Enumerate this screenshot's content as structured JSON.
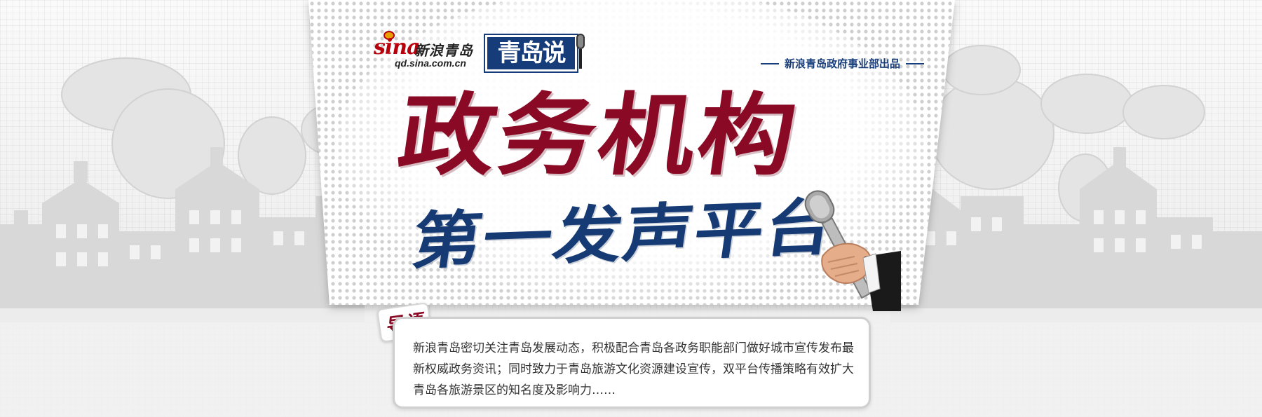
{
  "brand": {
    "sina_mark": "sina",
    "sina_name": "新浪青岛",
    "sina_url": "qd.sina.com.cn",
    "program_logo": "青岛说",
    "producer": "新浪青岛政府事业部出品"
  },
  "headline": {
    "line1": "政务机构",
    "line2": "第一发声平台"
  },
  "intro": {
    "tag": "导语",
    "text": "新浪青岛密切关注青岛发展动态，积极配合青岛各政务职能部门做好城市宣传发布最新权威政务资讯；同时致力于青岛旅游文化资源建设宣传，双平台传播策略有效扩大青岛各旅游景区的知名度及影响力……"
  },
  "icons": [
    "microphone-icon",
    "hand-microphone-icon",
    "sina-eye-icon"
  ],
  "colors": {
    "crimson": "#8a0a25",
    "navy": "#163a73",
    "sina_red": "#b8000c",
    "background": "#f4f4f4"
  }
}
